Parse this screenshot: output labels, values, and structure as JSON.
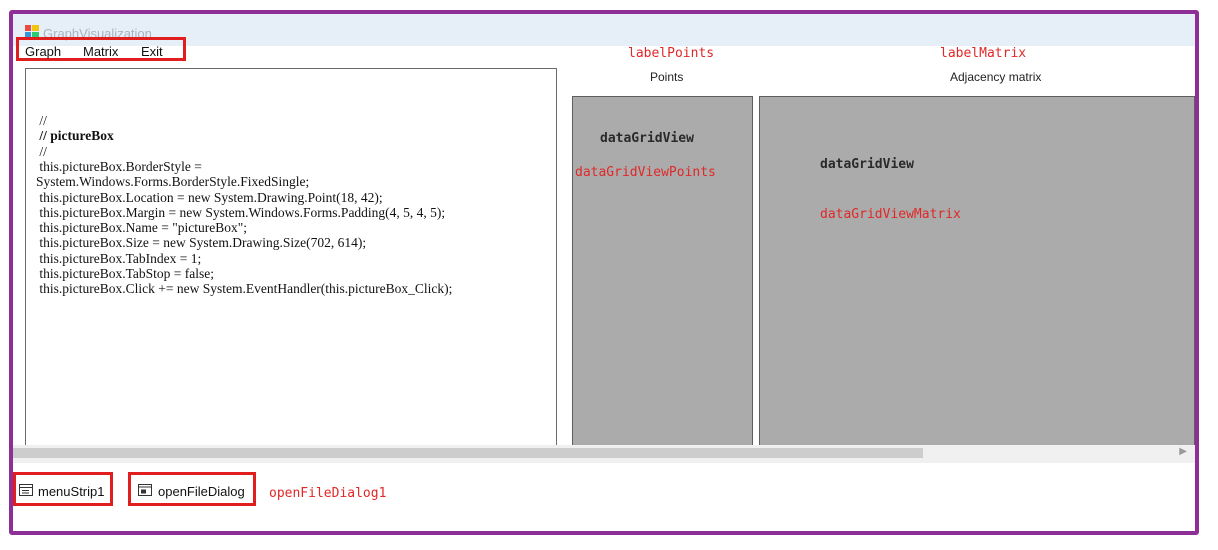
{
  "window": {
    "title": "GraphVisualization"
  },
  "menu": [
    "Graph",
    "Matrix",
    "Exit"
  ],
  "annotations": {
    "label_points": "labelPoints",
    "label_matrix": "labelMatrix",
    "open_file_dialog1": "openFileDialog1"
  },
  "headers": {
    "points": "Points",
    "matrix": "Adjacency matrix"
  },
  "grids": {
    "points": {
      "type": "dataGridView",
      "name": "dataGridViewPoints"
    },
    "matrix": {
      "type": "dataGridView",
      "name": "dataGridViewMatrix"
    }
  },
  "picturebox_code": [
    " //",
    " // pictureBox",
    " //",
    " this.pictureBox.BorderStyle =",
    "System.Windows.Forms.BorderStyle.FixedSingle;",
    " this.pictureBox.Location = new System.Drawing.Point(18, 42);",
    " this.pictureBox.Margin = new System.Windows.Forms.Padding(4, 5, 4, 5);",
    " this.pictureBox.Name = \"pictureBox\";",
    " this.pictureBox.Size = new System.Drawing.Size(702, 614);",
    " this.pictureBox.TabIndex = 1;",
    " this.pictureBox.TabStop = false;",
    " this.pictureBox.Click += new System.EventHandler(this.pictureBox_Click);"
  ],
  "tray": {
    "menu_strip": "menuStrip1",
    "open_file_dialog": "openFileDialog"
  },
  "icons": {
    "app": "app-window-icon",
    "menu_strip": "menu-strip-icon",
    "open_file_dialog": "open-file-dialog-icon",
    "scroll_right": "chevron-right-icon"
  },
  "colors": {
    "frame": "#8e2f97",
    "highlight": "#e01e1e",
    "annotation": "#e02828",
    "grid": "#ababab"
  }
}
